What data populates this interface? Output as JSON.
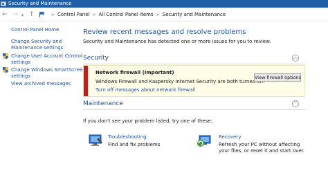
{
  "window": {
    "title": "Security and Maintenance"
  },
  "address": {
    "crumbs": [
      "Control Panel",
      "All Control Panel Items",
      "Security and Maintenance"
    ]
  },
  "sidebar": {
    "items": [
      {
        "label": "Control Panel Home"
      },
      {
        "label_line1": "Change Security and",
        "label_line2": "Maintenance settings"
      },
      {
        "label_line1": "Change User Account Control",
        "label_line2": "settings"
      },
      {
        "label_line1": "Change Windows SmartScreen",
        "label_line2": "settings"
      },
      {
        "label": "View archived messages"
      }
    ]
  },
  "main": {
    "heading": "Review recent messages and resolve problems",
    "subheading": "Security and Maintenance has detected one or more issues for you to review.",
    "security": {
      "label": "Security",
      "alert": {
        "title": "Network firewall  (Important)",
        "text": "Windows Firewall and Kaspersky Internet Security are both turned off.",
        "link": "Turn off messages about network firewall",
        "button": "View firewall options",
        "color": "#c91a1a"
      }
    },
    "maintenance": {
      "label": "Maintenance"
    },
    "prompt": "If you don't see your problem listed, try one of these:",
    "options": {
      "troubleshooting": {
        "title": "Troubleshooting",
        "desc": "Find and fix problems"
      },
      "recovery": {
        "title": "Recovery",
        "desc_line1": "Refresh your PC without affecting",
        "desc_line2": "your files, or reset it and start over."
      }
    }
  },
  "colors": {
    "accent": "#1e4fa3",
    "titlebar": "#1f5fa8",
    "alert_bg": "#fffde8"
  }
}
